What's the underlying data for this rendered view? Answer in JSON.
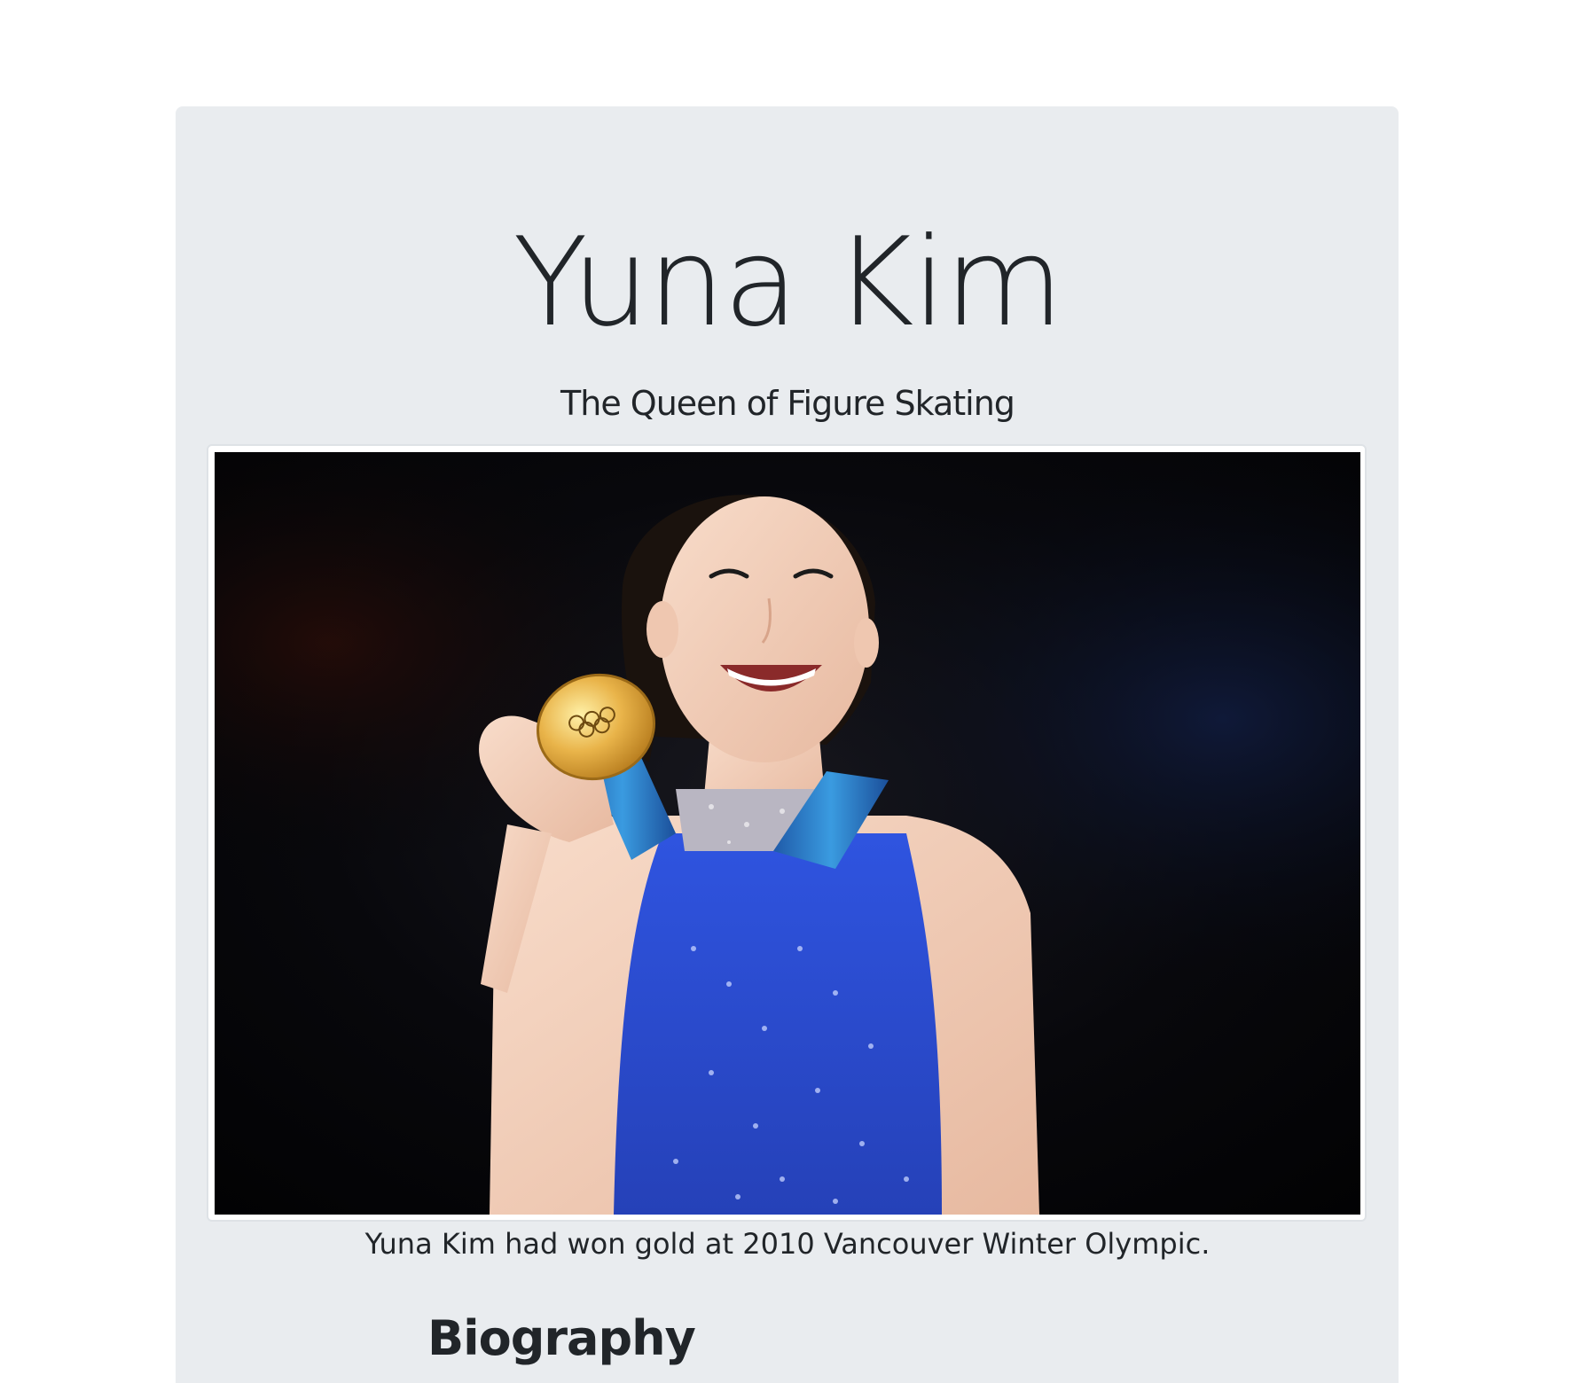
{
  "page": {
    "title": "Yuna Kim",
    "subtitle": "The Queen of Figure Skating"
  },
  "figure": {
    "image_subject": "Yuna Kim smiling and holding an Olympic gold medal",
    "caption": "Yuna Kim had won gold at 2010 Vancouver Winter Olympic."
  },
  "sections": {
    "biography_heading": "Biography"
  },
  "colors": {
    "page_background": "#ffffff",
    "jumbotron_background": "#e9ecef",
    "text": "#212529",
    "thumbnail_border": "#dee2e6",
    "photo_background": "#050506",
    "dress_blue": "#2d4fd6",
    "ribbon_blue": "#2a7fd0",
    "medal_gold": "#e7b03f",
    "skin": "#f5d5c3"
  }
}
